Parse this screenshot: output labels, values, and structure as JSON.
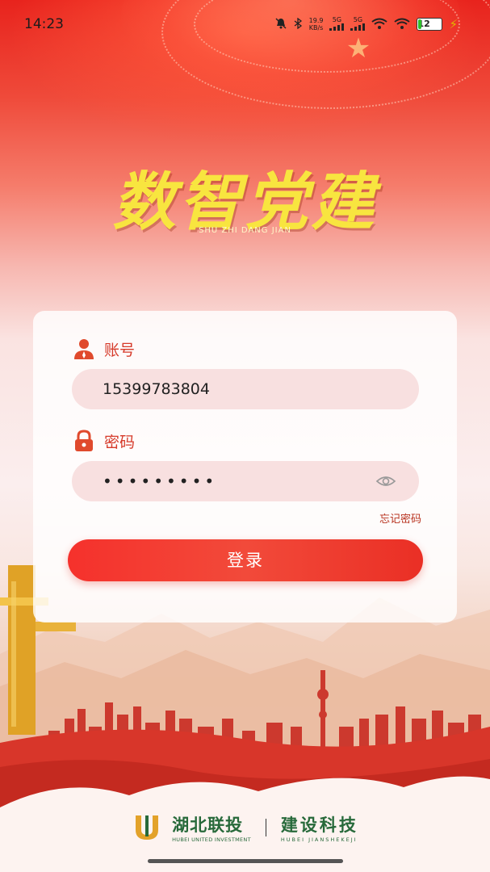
{
  "status_bar": {
    "time": "14:23",
    "net_speed_value": "19.9",
    "net_speed_unit": "KB/s",
    "signal1_label": "5G",
    "signal2_label": "5G",
    "battery": "12"
  },
  "app": {
    "title": "数智党建",
    "subtitle": "SHU ZHI DANG JIAN"
  },
  "login_form": {
    "account_label": "账号",
    "account_value": "15399783804",
    "password_label": "密码",
    "password_value": "•••••••••",
    "forgot_password": "忘记密码",
    "login_button": "登录"
  },
  "footer": {
    "brand1_cn": "湖北联投",
    "brand1_en": "HUBEI UNITED INVESTMENT",
    "brand2_cn": "建设科技",
    "brand2_en": "HUBEI JIANSHEKEJI"
  },
  "colors": {
    "primary_red": "#e8231d",
    "title_yellow": "#f8e53f",
    "brand_green": "#27693a",
    "field_bg": "#f8e0e0"
  },
  "icons": {
    "account": "user-icon",
    "password": "lock-icon",
    "show_password": "eye-icon"
  }
}
